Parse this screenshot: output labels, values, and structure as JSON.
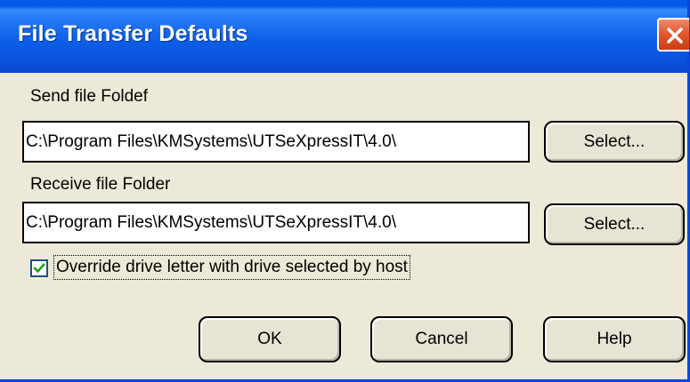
{
  "window": {
    "title": "File Transfer Defaults",
    "close_icon": "close-x-icon"
  },
  "send": {
    "label": "Send file Foldef",
    "path": "C:\\Program Files\\KMSystems\\UTSeXpressIT\\4.0\\",
    "select_label": "Select..."
  },
  "receive": {
    "label": "Receive file Folder",
    "path": "C:\\Program Files\\KMSystems\\UTSeXpressIT\\4.0\\",
    "select_label": "Select..."
  },
  "override": {
    "label": "Override drive letter with drive selected by host",
    "checked": true
  },
  "buttons": {
    "ok": "OK",
    "cancel": "Cancel",
    "help": "Help"
  },
  "colors": {
    "titlebar": "#0a53e0",
    "close": "#e2582f",
    "dialog_bg": "#ece9d8",
    "check": "#21a121"
  }
}
